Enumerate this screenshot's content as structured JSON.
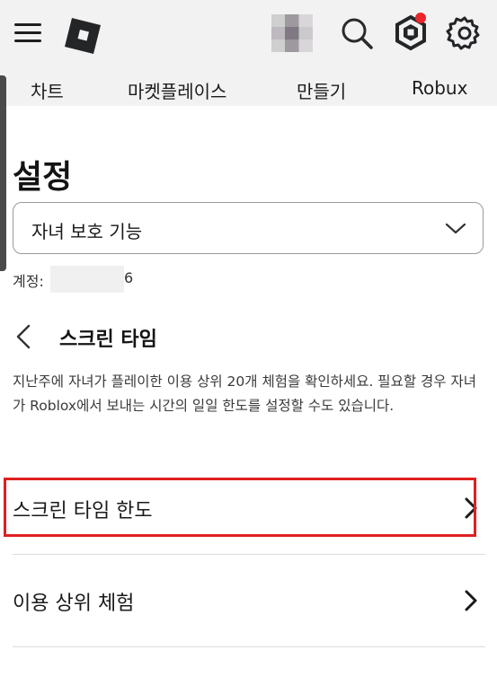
{
  "header": {
    "menu_icon": "hamburger-menu-icon",
    "logo_icon": "roblox-logo-icon",
    "search_icon": "search-icon",
    "robux_icon": "robux-hexagon-icon",
    "settings_icon": "gear-icon",
    "notification_color": "#e8262b"
  },
  "nav": {
    "items": [
      "차트",
      "마켓플레이스",
      "만들기",
      "Robux"
    ]
  },
  "page": {
    "title": "설정",
    "dropdown_value": "자녀 보호 기능",
    "account_label": "계정:",
    "account_suffix": "6"
  },
  "section": {
    "title": "스크린 타임",
    "description": "지난주에 자녀가 플레이한 이용 상위 20개 체험을 확인하세요. 필요할 경우 자녀가 Roblox에서 보내는 시간의 일일 한도를 설정할 수도 있습니다."
  },
  "rows": [
    {
      "label": "스크린 타임 한도"
    },
    {
      "label": "이용 상위 체험"
    }
  ],
  "colors": {
    "highlight": "#e02020",
    "topbar": "#f2f2f3"
  }
}
